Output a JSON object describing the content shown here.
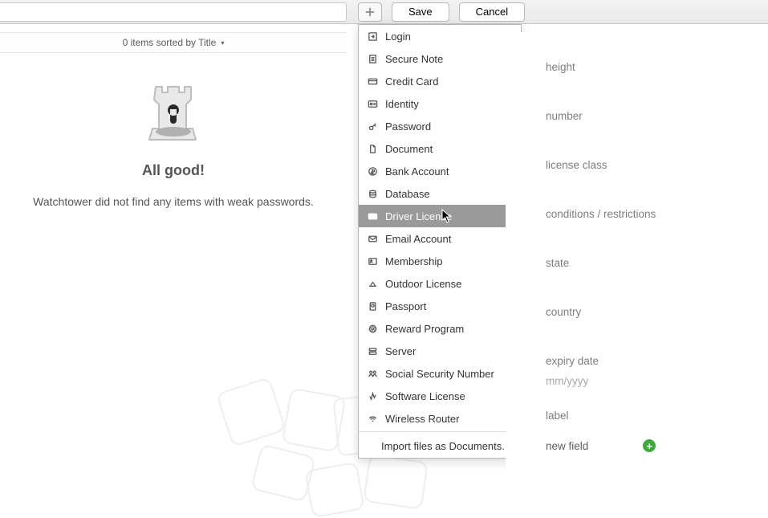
{
  "toolbar": {
    "save_label": "Save",
    "cancel_label": "Cancel"
  },
  "list_header": {
    "text": "0 items sorted by Title"
  },
  "empty_state": {
    "title": "All good!",
    "subtitle": "Watchtower did not find any items with weak passwords."
  },
  "menu": {
    "items": [
      {
        "label": "Login",
        "icon": "login-icon"
      },
      {
        "label": "Secure Note",
        "icon": "note-icon"
      },
      {
        "label": "Credit Card",
        "icon": "credit-card-icon"
      },
      {
        "label": "Identity",
        "icon": "identity-icon"
      },
      {
        "label": "Password",
        "icon": "key-icon"
      },
      {
        "label": "Document",
        "icon": "document-icon"
      },
      {
        "label": "Bank Account",
        "icon": "bank-icon"
      },
      {
        "label": "Database",
        "icon": "database-icon"
      },
      {
        "label": "Driver License",
        "icon": "license-icon",
        "selected": true
      },
      {
        "label": "Email Account",
        "icon": "email-icon"
      },
      {
        "label": "Membership",
        "icon": "membership-icon"
      },
      {
        "label": "Outdoor License",
        "icon": "outdoor-icon"
      },
      {
        "label": "Passport",
        "icon": "passport-icon"
      },
      {
        "label": "Reward Program",
        "icon": "reward-icon"
      },
      {
        "label": "Server",
        "icon": "server-icon"
      },
      {
        "label": "Social Security Number",
        "icon": "ssn-icon"
      },
      {
        "label": "Software License",
        "icon": "software-icon"
      },
      {
        "label": "Wireless Router",
        "icon": "wifi-icon"
      }
    ],
    "import_label": "Import files as Documents..."
  },
  "detail_fields": {
    "labels": [
      "height",
      "number",
      "license class",
      "conditions / restrictions",
      "state",
      "country",
      "expiry date"
    ],
    "expiry_hint": "mm/yyyy",
    "label_field_label": "label",
    "new_field_label": "new field"
  }
}
